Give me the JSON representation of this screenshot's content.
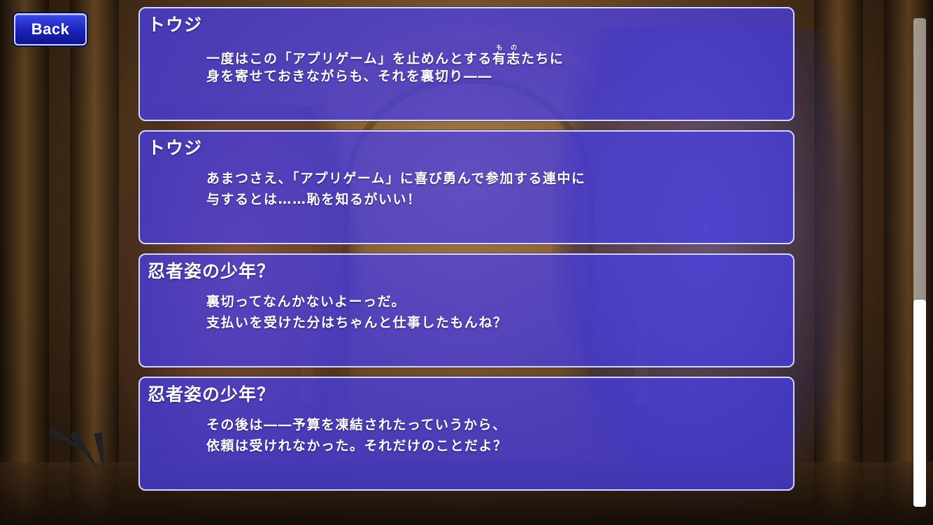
{
  "back_button": {
    "label": "Back"
  },
  "log": [
    {
      "speaker": "トウジ",
      "line1_before": "一度はこの「アプリゲーム」を止めんとする",
      "line1_ruby_base": "有志",
      "line1_ruby_text": "もの",
      "line1_after": "たちに",
      "line2": "身を寄せておきながらも、それを裏切り――"
    },
    {
      "speaker": "トウジ",
      "line1": "あまつさえ、「アプリゲーム」に喜び勇んで参加する連中に",
      "line2": "与するとは……恥を知るがいい！"
    },
    {
      "speaker": "忍者姿の少年？",
      "line1": "裏切ってなんかないよーっだ。",
      "line2": "支払いを受けた分はちゃんと仕事したもんね？"
    },
    {
      "speaker": "忍者姿の少年？",
      "line1": "その後は――予算を凍結されたっていうから、",
      "line2": "依頼は受けれなかった。それだけのことだよ？"
    }
  ],
  "scrollbar": {
    "position_fraction": 1.0
  }
}
